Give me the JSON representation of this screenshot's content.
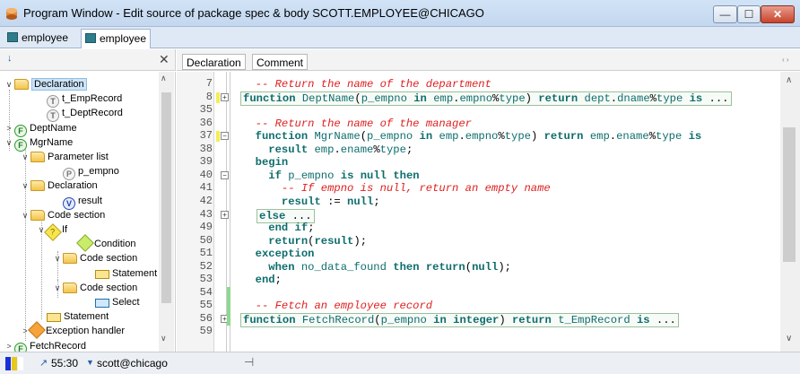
{
  "window": {
    "title": "Program Window - Edit source of package spec & body SCOTT.EMPLOYEE@CHICAGO",
    "buttons": {
      "minimize": "—",
      "maximize": "☐",
      "close": "✕"
    }
  },
  "doc_tabs": [
    {
      "label": "employee"
    },
    {
      "label": "employee"
    }
  ],
  "tree_panel": {
    "sort_icon": "sort-az-icon",
    "close_label": "✕",
    "nodes": [
      {
        "label": "Declaration",
        "icon": "folder-icon"
      },
      {
        "label": "t_EmpRecord",
        "icon": "type-icon"
      },
      {
        "label": "t_DeptRecord",
        "icon": "type-icon"
      },
      {
        "label": "DeptName",
        "icon": "function-icon"
      },
      {
        "label": "MgrName",
        "icon": "function-icon"
      },
      {
        "label": "Parameter list",
        "icon": "folder-icon"
      },
      {
        "label": "p_empno",
        "icon": "parameter-icon"
      },
      {
        "label": "Declaration",
        "icon": "folder-icon"
      },
      {
        "label": "result",
        "icon": "variable-icon"
      },
      {
        "label": "Code section",
        "icon": "folder-icon"
      },
      {
        "label": "If",
        "icon": "if-icon"
      },
      {
        "label": "Condition",
        "icon": "condition-icon"
      },
      {
        "label": "Code section",
        "icon": "folder-icon"
      },
      {
        "label": "Statement",
        "icon": "statement-icon"
      },
      {
        "label": "Code section",
        "icon": "folder-icon"
      },
      {
        "label": "Select",
        "icon": "select-icon"
      },
      {
        "label": "Statement",
        "icon": "statement-icon"
      },
      {
        "label": "Exception handler",
        "icon": "exception-icon"
      },
      {
        "label": "FetchRecord",
        "icon": "function-icon"
      }
    ]
  },
  "editor": {
    "tabs": [
      "Declaration",
      "Comment"
    ],
    "scroll_arrows": "‹ ›",
    "lines": [
      {
        "num": "7",
        "text": "  -- Return the name of the department"
      },
      {
        "num": "8",
        "text": "function DeptName(p_empno in emp.empno%type) return dept.dname%type is ..."
      },
      {
        "num": "35",
        "text": ""
      },
      {
        "num": "36",
        "text": "  -- Return the name of the manager"
      },
      {
        "num": "37",
        "text": "  function MgrName(p_empno in emp.empno%type) return emp.ename%type is"
      },
      {
        "num": "38",
        "text": "    result emp.ename%type;"
      },
      {
        "num": "39",
        "text": "  begin"
      },
      {
        "num": "40",
        "text": "    if p_empno is null then"
      },
      {
        "num": "41",
        "text": "      -- If empno is null, return an empty name"
      },
      {
        "num": "42",
        "text": "      result := null;"
      },
      {
        "num": "43",
        "text": "else ..."
      },
      {
        "num": "49",
        "text": "    end if;"
      },
      {
        "num": "50",
        "text": "    return(result);"
      },
      {
        "num": "51",
        "text": "  exception"
      },
      {
        "num": "52",
        "text": "    when no_data_found then return(null);"
      },
      {
        "num": "53",
        "text": "  end;"
      },
      {
        "num": "54",
        "text": ""
      },
      {
        "num": "55",
        "text": "  -- Fetch an employee record"
      },
      {
        "num": "56",
        "text": "function FetchRecord(p_empno in integer) return t_EmpRecord is ..."
      },
      {
        "num": "59",
        "text": ""
      }
    ]
  },
  "statusbar": {
    "position": "55:30",
    "connection": "scott@chicago",
    "pin_icon": "pin-icon",
    "colors": [
      "#1a2fd8",
      "#e8c81a",
      "#ffffff"
    ]
  }
}
